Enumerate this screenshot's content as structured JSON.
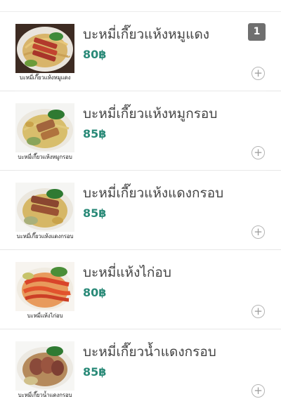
{
  "menu": {
    "items": [
      {
        "name": "บะหมี่เกี๊ยวแห้งหมูแดง",
        "price": "80฿",
        "image_caption": "บะหมี่เกี๊ยวแห้งหมูแดง",
        "quantity": "1",
        "add_icon": "plus-circle-icon"
      },
      {
        "name": "บะหมี่เกี๊ยวแห้งหมูกรอบ",
        "price": "85฿",
        "image_caption": "บะหมี่เกี๊ยวแห้งหมูกรอบ",
        "add_icon": "plus-circle-icon"
      },
      {
        "name": "บะหมี่เกี๊ยวแห้งแดงกรอบ",
        "price": "85฿",
        "image_caption": "บะหมี่เกี๊ยวแห้งแดงกรอบ",
        "add_icon": "plus-circle-icon"
      },
      {
        "name": "บะหมี่แห้งไก่อบ",
        "price": "80฿",
        "image_caption": "บะหมี่แห้งไก่อบ",
        "add_icon": "plus-circle-icon"
      },
      {
        "name": "บะหมี่เกี๊ยวน้ำแดงกรอบ",
        "price": "85฿",
        "image_caption": "บะหมี่เกี๊ยวน้ำแดงกรอบ",
        "add_icon": "plus-circle-icon"
      }
    ]
  },
  "colors": {
    "price": "#2a8a78",
    "badge": "#6f6f6f",
    "name": "#444444"
  }
}
